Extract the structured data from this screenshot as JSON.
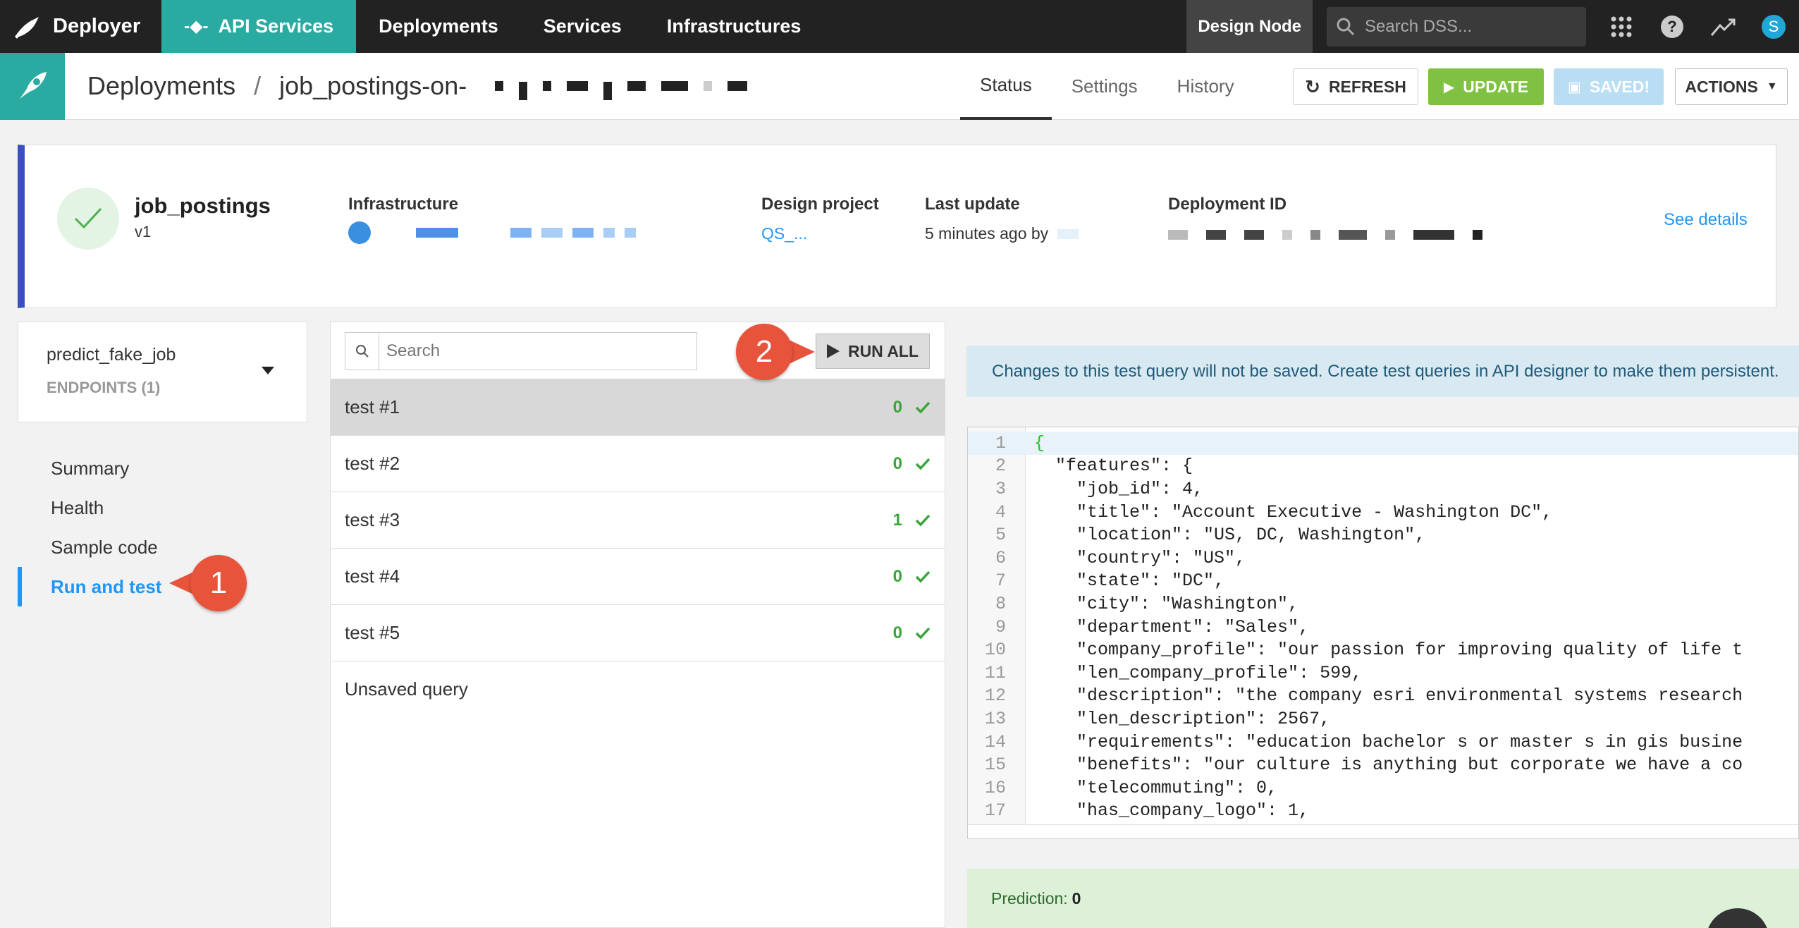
{
  "topnav": {
    "brand": "Deployer",
    "tabs": [
      {
        "label": "API Services",
        "active": true
      },
      {
        "label": "Deployments",
        "active": false
      },
      {
        "label": "Services",
        "active": false
      },
      {
        "label": "Infrastructures",
        "active": false
      }
    ],
    "design_node": "Design Node",
    "search_placeholder": "Search DSS...",
    "avatar_letter": "S",
    "accent_color": "#2aaba2"
  },
  "subbar": {
    "crumb_root": "Deployments",
    "crumb_separator": "/",
    "crumb_current": "job_postings-on-",
    "tabs": [
      {
        "label": "Status",
        "active": true
      },
      {
        "label": "Settings",
        "active": false
      },
      {
        "label": "History",
        "active": false
      }
    ],
    "buttons": {
      "refresh": "REFRESH",
      "update": "UPDATE",
      "saved": "SAVED!",
      "actions": "ACTIONS"
    }
  },
  "status_card": {
    "name": "job_postings",
    "version": "v1",
    "infrastructure_label": "Infrastructure",
    "design_project_label": "Design project",
    "design_project_value": "QS_...",
    "last_update_label": "Last update",
    "last_update_value": "5 minutes ago by",
    "deployment_id_label": "Deployment ID",
    "see_details": "See details"
  },
  "endpoint": {
    "name": "predict_fake_job",
    "count_label": "ENDPOINTS (1)"
  },
  "leftnav": [
    {
      "label": "Summary",
      "active": false
    },
    {
      "label": "Health",
      "active": false
    },
    {
      "label": "Sample code",
      "active": false
    },
    {
      "label": "Run and test",
      "active": true
    }
  ],
  "tests": {
    "search_placeholder": "Search",
    "run_all": "RUN ALL",
    "items": [
      {
        "label": "test #1",
        "result": "0",
        "selected": true
      },
      {
        "label": "test #2",
        "result": "0",
        "selected": false
      },
      {
        "label": "test #3",
        "result": "1",
        "selected": false
      },
      {
        "label": "test #4",
        "result": "0",
        "selected": false
      },
      {
        "label": "test #5",
        "result": "0",
        "selected": false
      }
    ],
    "unsaved": "Unsaved query"
  },
  "notice": "Changes to this test query will not be saved. Create test queries in API designer to make them persistent.",
  "code_lines": [
    "{",
    "  \"features\": {",
    "    \"job_id\": 4,",
    "    \"title\": \"Account Executive - Washington DC\",",
    "    \"location\": \"US, DC, Washington\",",
    "    \"country\": \"US\",",
    "    \"state\": \"DC\",",
    "    \"city\": \"Washington\",",
    "    \"department\": \"Sales\",",
    "    \"company_profile\": \"our passion for improving quality of life t",
    "    \"len_company_profile\": 599,",
    "    \"description\": \"the company esri environmental systems research",
    "    \"len_description\": 2567,",
    "    \"requirements\": \"education bachelor s or master s in gis busine",
    "    \"benefits\": \"our culture is anything but corporate we have a co",
    "    \"telecommuting\": 0,",
    "    \"has_company_logo\": 1,"
  ],
  "prediction": {
    "label": "Prediction:",
    "value": "0"
  },
  "callouts": {
    "one": "1",
    "two": "2"
  }
}
